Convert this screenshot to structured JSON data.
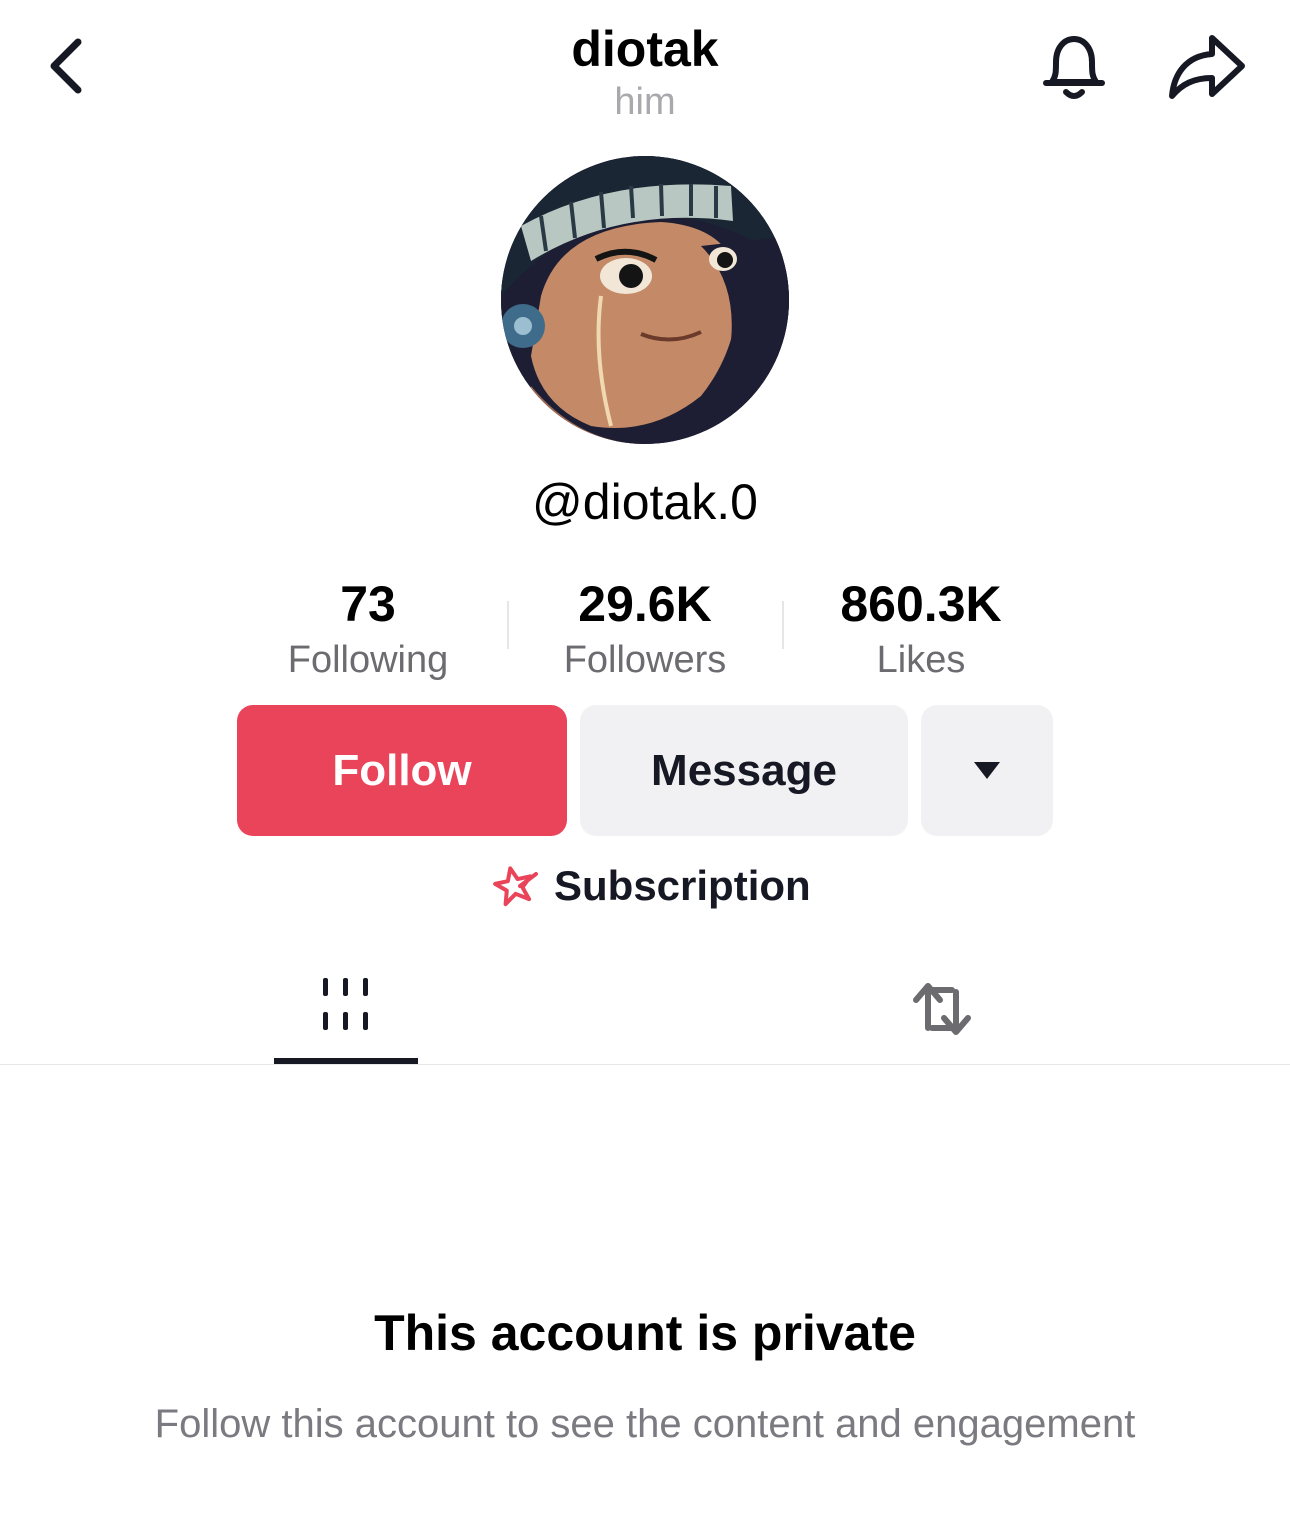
{
  "header": {
    "title": "diotak",
    "pronoun": "him",
    "back_icon": "chevron-left-icon",
    "bell_icon": "bell-icon",
    "share_icon": "share-arrow-icon"
  },
  "profile": {
    "handle": "@diotak.0",
    "avatar": "anime-character-avatar"
  },
  "stats": [
    {
      "value": "73",
      "label": "Following"
    },
    {
      "value": "29.6K",
      "label": "Followers"
    },
    {
      "value": "860.3K",
      "label": "Likes"
    }
  ],
  "actions": {
    "follow_label": "Follow",
    "message_label": "Message",
    "more_icon": "caret-down-icon"
  },
  "subscription": {
    "label": "Subscription",
    "icon": "subscription-star-icon"
  },
  "tabs": [
    {
      "name": "videos",
      "icon": "grid-lines-icon",
      "active": true
    },
    {
      "name": "reposts",
      "icon": "repost-icon",
      "active": false
    }
  ],
  "private": {
    "title": "This account is private",
    "subtitle": "Follow this account to see the content and engagement"
  },
  "colors": {
    "accent": "#ea445a",
    "button_gray": "#f1f1f3",
    "text_primary": "#161823",
    "text_secondary": "#7a7a80"
  }
}
